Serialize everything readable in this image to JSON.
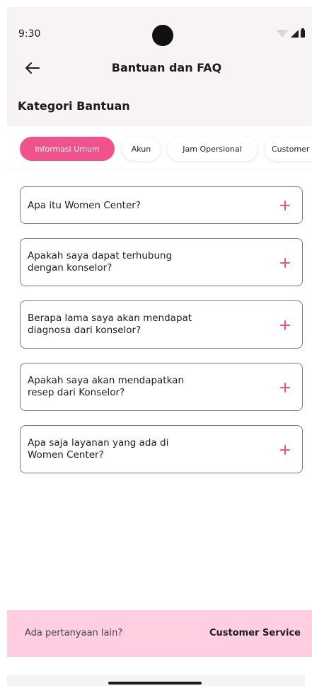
{
  "status_bar": {
    "time": "9:30"
  },
  "header": {
    "title": "Bantuan dan FAQ",
    "back_icon": "arrow-left-icon"
  },
  "section": {
    "title": "Kategori Bantuan"
  },
  "categories": [
    {
      "label": "Informasi Umum",
      "active": true
    },
    {
      "label": "Akun",
      "active": false
    },
    {
      "label": "Jam Opersional",
      "active": false
    },
    {
      "label": "Customer Service",
      "active": false
    }
  ],
  "faqs": [
    {
      "question": "Apa itu Women Center?"
    },
    {
      "question": "Apakah saya dapat terhubung\ndengan konselor?"
    },
    {
      "question": "Berapa lama saya akan mendapat\ndiagnosa dari konselor?"
    },
    {
      "question": "Apakah saya akan mendapatkan\nresep dari Konselor?"
    },
    {
      "question": "Apa saja layanan yang ada di\nWomen Center?"
    }
  ],
  "footer": {
    "prompt": "Ada pertanyaan lain?",
    "link": "Customer Service"
  },
  "colors": {
    "accent": "#f0528c",
    "footer_bg": "#ffcee0",
    "header_bg": "#f8f3f4"
  }
}
